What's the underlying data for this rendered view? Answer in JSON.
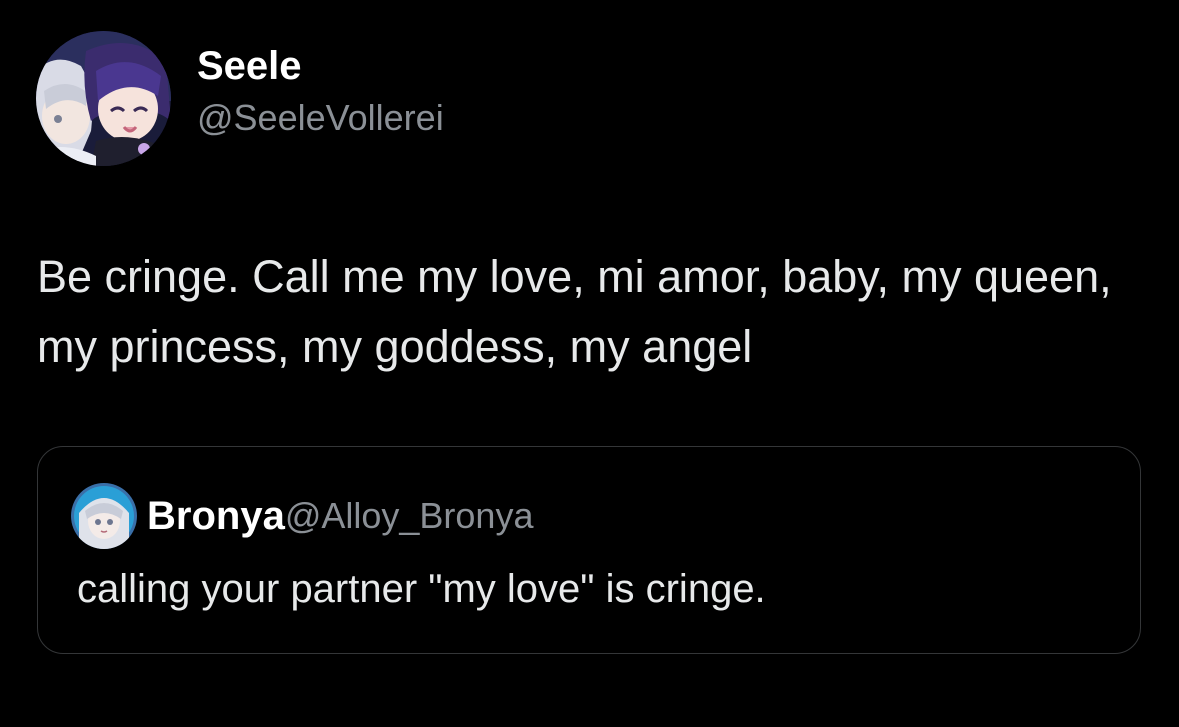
{
  "post": {
    "author": {
      "display_name": "Seele",
      "handle": "@SeeleVollerei",
      "avatar_icon": "profile-avatar"
    },
    "text": "Be cringe. Call me my love, mi amor, baby, my queen, my princess, my goddess, my angel"
  },
  "quoted_post": {
    "author": {
      "display_name": "Bronya",
      "handle": "@Alloy_Bronya",
      "avatar_icon": "profile-avatar"
    },
    "text": "calling your partner \"my love\" is cringe."
  },
  "colors": {
    "background": "#000000",
    "primary_text": "#e7e9ea",
    "secondary_text": "#8b9096",
    "card_border": "#343638"
  }
}
